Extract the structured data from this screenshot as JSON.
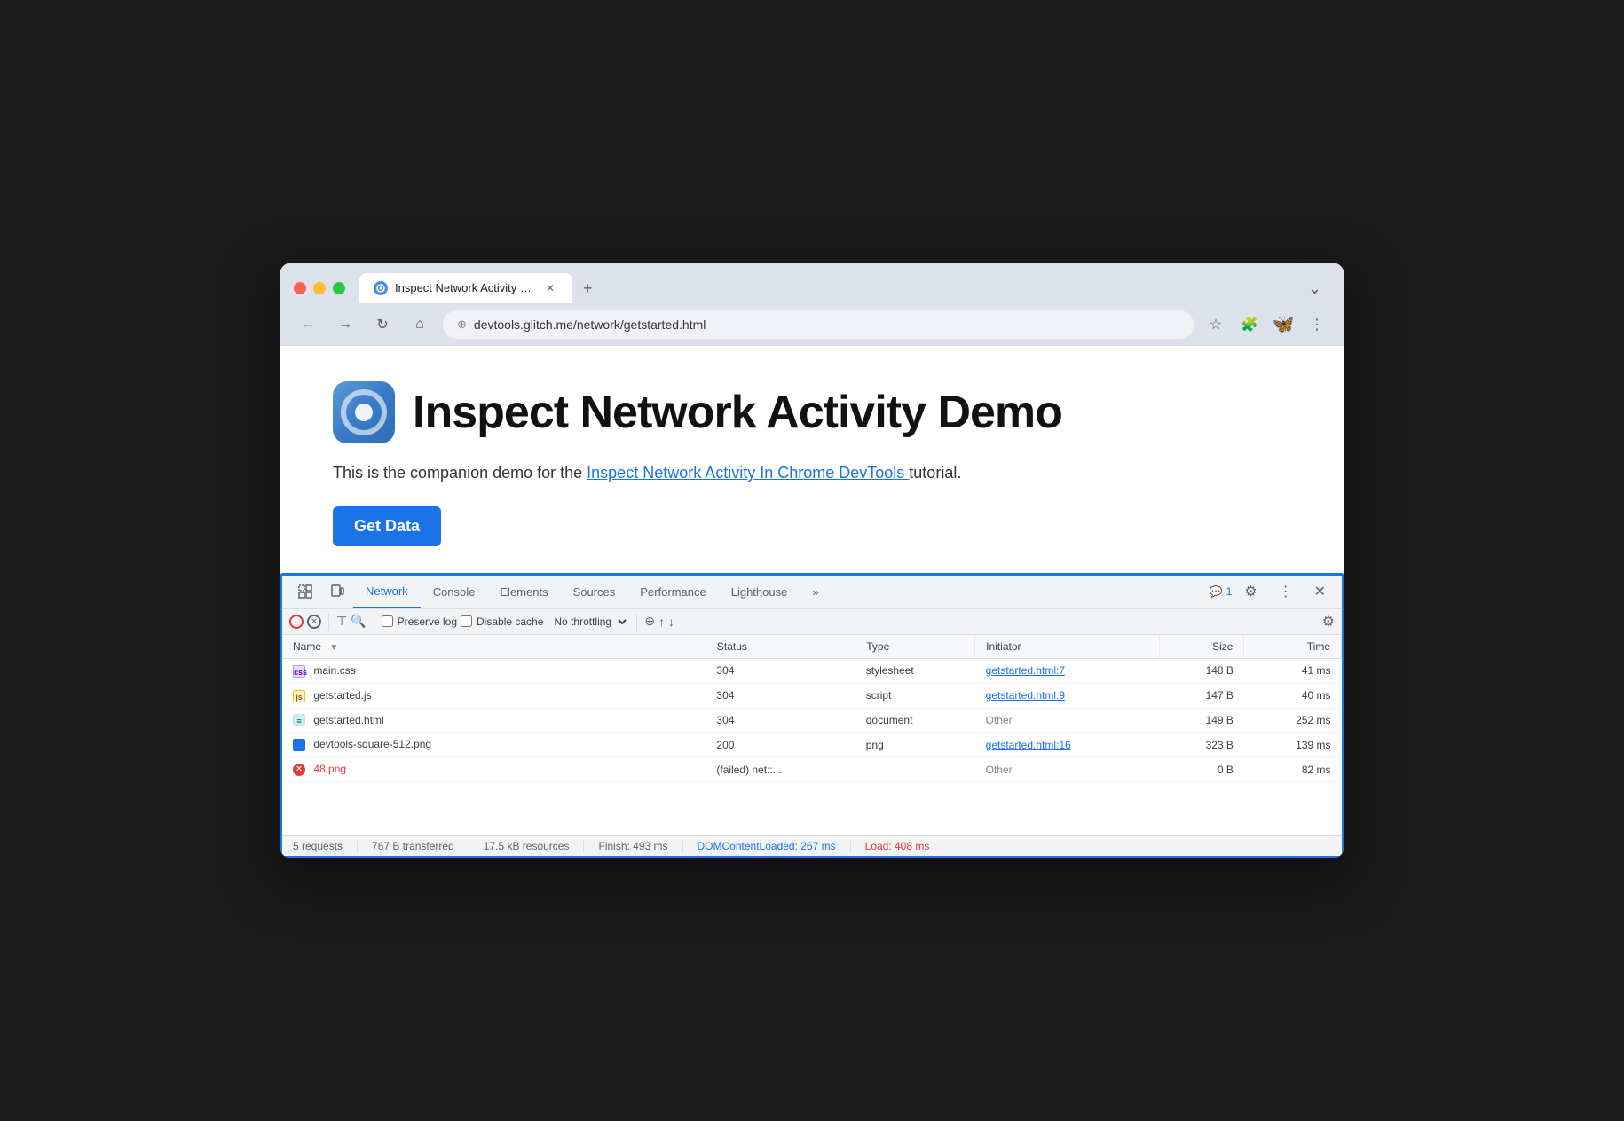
{
  "browser": {
    "tab": {
      "favicon": "🌐",
      "title": "Inspect Network Activity Dem",
      "close_label": "✕",
      "new_tab_label": "+",
      "dropdown_label": "⌄"
    },
    "nav": {
      "back_label": "←",
      "forward_label": "→",
      "reload_label": "↻",
      "home_label": "⌂",
      "url": "devtools.glitch.me/network/getstarted.html",
      "tracking_icon": "⊕",
      "star_label": "☆",
      "extension_label": "🧩",
      "avatar_label": "🦋",
      "menu_label": "⋮"
    }
  },
  "page": {
    "logo_alt": "Chrome DevTools logo",
    "title": "Inspect Network Activity Demo",
    "description_prefix": "This is the companion demo for the ",
    "description_link": "Inspect Network Activity In Chrome DevTools ",
    "description_suffix": "tutorial.",
    "link_url": "#",
    "button_label": "Get Data"
  },
  "devtools": {
    "tabs": [
      {
        "label": "Network",
        "active": true
      },
      {
        "label": "Console",
        "active": false
      },
      {
        "label": "Elements",
        "active": false
      },
      {
        "label": "Sources",
        "active": false
      },
      {
        "label": "Performance",
        "active": false
      },
      {
        "label": "Lighthouse",
        "active": false
      },
      {
        "label": "»",
        "active": false
      }
    ],
    "badge": "💬 1",
    "toolbar": {
      "record_label": "",
      "clear_label": "",
      "filter_label": "",
      "search_label": "",
      "preserve_log_label": "Preserve log",
      "disable_cache_label": "Disable cache",
      "throttle_label": "No throttling",
      "throttle_arrow": "▾",
      "wifi_label": "⊕",
      "upload_label": "↑",
      "download_label": "↓",
      "settings_label": "⚙"
    },
    "network_table": {
      "columns": [
        {
          "label": "Name",
          "sort_icon": "▼"
        },
        {
          "label": "Status"
        },
        {
          "label": "Type"
        },
        {
          "label": "Initiator"
        },
        {
          "label": "Size",
          "align": "right"
        },
        {
          "label": "Time",
          "align": "right"
        }
      ],
      "rows": [
        {
          "icon_type": "css",
          "icon_symbol": "",
          "name": "main.css",
          "status": "304",
          "type": "stylesheet",
          "initiator": "getstarted.html:7",
          "initiator_link": true,
          "size": "148 B",
          "time": "41 ms",
          "error": false
        },
        {
          "icon_type": "js",
          "icon_symbol": "",
          "name": "getstarted.js",
          "status": "304",
          "type": "script",
          "initiator": "getstarted.html:9",
          "initiator_link": true,
          "size": "147 B",
          "time": "40 ms",
          "error": false
        },
        {
          "icon_type": "html",
          "icon_symbol": "",
          "name": "getstarted.html",
          "status": "304",
          "type": "document",
          "initiator": "Other",
          "initiator_link": false,
          "size": "149 B",
          "time": "252 ms",
          "error": false
        },
        {
          "icon_type": "png",
          "icon_symbol": "",
          "name": "devtools-square-512.png",
          "status": "200",
          "type": "png",
          "initiator": "getstarted.html:16",
          "initiator_link": true,
          "size": "323 B",
          "time": "139 ms",
          "error": false
        },
        {
          "icon_type": "error",
          "icon_symbol": "✕",
          "name": "48.png",
          "status": "(failed)  net::...",
          "type": "",
          "initiator": "Other",
          "initiator_link": false,
          "size": "0 B",
          "time": "82 ms",
          "error": true
        }
      ]
    },
    "status_bar": {
      "requests": "5 requests",
      "transferred": "767 B transferred",
      "resources": "17.5 kB resources",
      "finish": "Finish: 493 ms",
      "dom_content_loaded": "DOMContentLoaded: 267 ms",
      "load": "Load: 408 ms"
    }
  }
}
